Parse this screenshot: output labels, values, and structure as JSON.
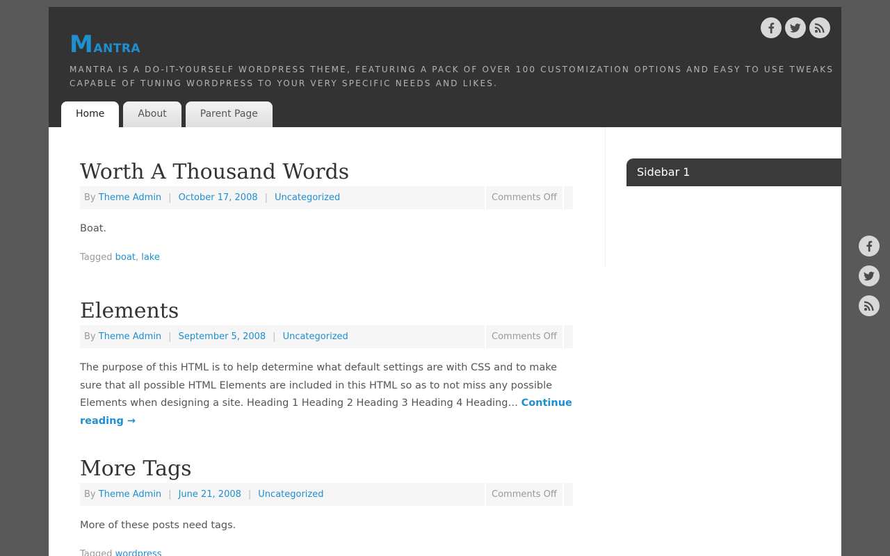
{
  "site": {
    "title_first": "M",
    "title_rest": "antra",
    "description": "Mantra is a do-it-yourself WordPress theme, featuring a pack of over 100 customization options and easy to use tweaks capable of tuning WordPress to your very specific needs and likes."
  },
  "social": [
    {
      "name": "Facebook",
      "icon": "facebook-icon"
    },
    {
      "name": "Twitter",
      "icon": "twitter-icon"
    },
    {
      "name": "RSS",
      "icon": "rss-icon"
    }
  ],
  "nav": [
    {
      "label": "Home",
      "active": true
    },
    {
      "label": "About",
      "active": false
    },
    {
      "label": "Parent Page",
      "active": false
    }
  ],
  "posts": [
    {
      "title": "Worth A Thousand Words",
      "by": "By",
      "author": "Theme Admin",
      "date": "October 17, 2008",
      "category": "Uncategorized",
      "comments": "Comments Off",
      "excerpt": "Boat.",
      "tagged_label": "Tagged",
      "tags": [
        "boat",
        "lake"
      ]
    },
    {
      "title": "Elements",
      "by": "By",
      "author": "Theme Admin",
      "date": "September 5, 2008",
      "category": "Uncategorized",
      "comments": "Comments Off",
      "excerpt": "The purpose of this HTML is to help determine what default settings are with CSS and to make sure that all possible HTML Elements are included in this HTML so as to not miss any possible Elements when designing a site. Heading 1 Heading 2 Heading 3 Heading 4 Heading…",
      "continue": "Continue reading →"
    },
    {
      "title": "More Tags",
      "by": "By",
      "author": "Theme Admin",
      "date": "June 21, 2008",
      "category": "Uncategorized",
      "comments": "Comments Off",
      "excerpt": "More of these posts need tags.",
      "tagged_label": "Tagged",
      "tags": [
        "wordpress"
      ]
    }
  ],
  "sidebar": {
    "title": "Sidebar 1"
  },
  "colors": {
    "accent": "#1e8fcf",
    "header_bg": "#333333",
    "page_bg": "#595959"
  }
}
